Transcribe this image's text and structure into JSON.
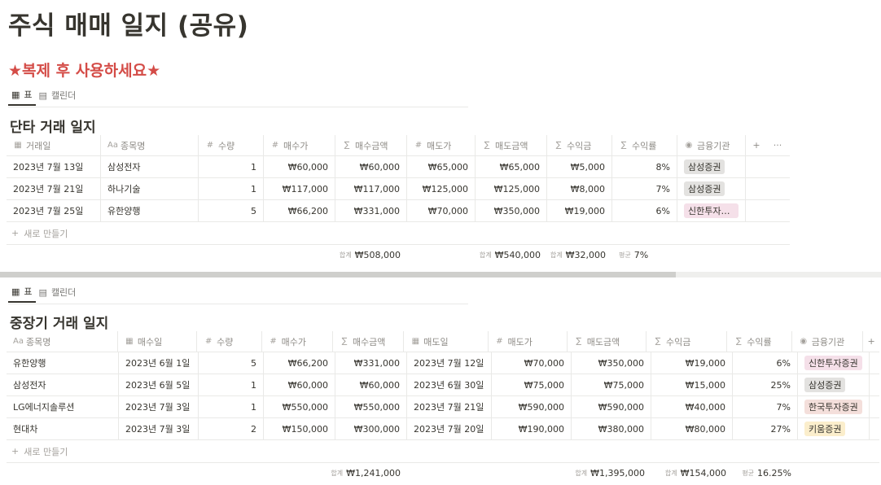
{
  "page_title": "주식 매매 일지 (공유)",
  "notice": "★복제 후 사용하세요★",
  "tabs": {
    "table": "표",
    "calendar": "캘린더"
  },
  "new_row_label": "새로 만들기",
  "short_term": {
    "title": "단타 거래 일지",
    "columns": [
      {
        "icon": "▦",
        "label": "거래일"
      },
      {
        "icon": "Aa",
        "label": "종목명"
      },
      {
        "icon": "#",
        "label": "수량"
      },
      {
        "icon": "#",
        "label": "매수가"
      },
      {
        "icon": "∑",
        "label": "매수금액"
      },
      {
        "icon": "#",
        "label": "매도가"
      },
      {
        "icon": "∑",
        "label": "매도금액"
      },
      {
        "icon": "∑",
        "label": "수익금"
      },
      {
        "icon": "∑",
        "label": "수익률"
      },
      {
        "icon": "◉",
        "label": "금융기관"
      }
    ],
    "rows": [
      {
        "date": "2023년 7월 13일",
        "name": "삼성전자",
        "qty": "1",
        "buy_price": "₩60,000",
        "buy_amount": "₩60,000",
        "sell_price": "₩65,000",
        "sell_amount": "₩65,000",
        "profit": "₩5,000",
        "rate": "8%",
        "broker": "삼성증권",
        "broker_color": "#e3e2e0"
      },
      {
        "date": "2023년 7월 21일",
        "name": "하나기술",
        "qty": "1",
        "buy_price": "₩117,000",
        "buy_amount": "₩117,000",
        "sell_price": "₩125,000",
        "sell_amount": "₩125,000",
        "profit": "₩8,000",
        "rate": "7%",
        "broker": "삼성증권",
        "broker_color": "#e3e2e0"
      },
      {
        "date": "2023년 7월 25일",
        "name": "유한양행",
        "qty": "5",
        "buy_price": "₩66,200",
        "buy_amount": "₩331,000",
        "sell_price": "₩70,000",
        "sell_amount": "₩350,000",
        "profit": "₩19,000",
        "rate": "6%",
        "broker": "신한투자증권",
        "broker_color": "#f5e0e9"
      }
    ],
    "footer": {
      "buy_amount_label": "합계",
      "buy_amount": "₩508,000",
      "sell_amount_label": "합계",
      "sell_amount": "₩540,000",
      "profit_label": "합계",
      "profit": "₩32,000",
      "rate_label": "평균",
      "rate": "7%"
    }
  },
  "mid_term": {
    "title": "중장기 거래 일지",
    "columns": [
      {
        "icon": "Aa",
        "label": "종목명"
      },
      {
        "icon": "▦",
        "label": "매수일"
      },
      {
        "icon": "#",
        "label": "수량"
      },
      {
        "icon": "#",
        "label": "매수가"
      },
      {
        "icon": "∑",
        "label": "매수금액"
      },
      {
        "icon": "▦",
        "label": "매도일"
      },
      {
        "icon": "#",
        "label": "매도가"
      },
      {
        "icon": "∑",
        "label": "매도금액"
      },
      {
        "icon": "∑",
        "label": "수익금"
      },
      {
        "icon": "∑",
        "label": "수익률"
      },
      {
        "icon": "◉",
        "label": "금융기관"
      }
    ],
    "rows": [
      {
        "name": "유한양행",
        "buy_date": "2023년 6월 1일",
        "qty": "5",
        "buy_price": "₩66,200",
        "buy_amount": "₩331,000",
        "sell_date": "2023년 7월 12일",
        "sell_price": "₩70,000",
        "sell_amount": "₩350,000",
        "profit": "₩19,000",
        "rate": "6%",
        "broker": "신한투자증권",
        "broker_color": "#f5e0e9"
      },
      {
        "name": "삼성전자",
        "buy_date": "2023년 6월 5일",
        "qty": "1",
        "buy_price": "₩60,000",
        "buy_amount": "₩60,000",
        "sell_date": "2023년 6월 30일",
        "sell_price": "₩75,000",
        "sell_amount": "₩75,000",
        "profit": "₩15,000",
        "rate": "25%",
        "broker": "삼성증권",
        "broker_color": "#e3e2e0"
      },
      {
        "name": "LG에너지솔루션",
        "buy_date": "2023년 7월 3일",
        "qty": "1",
        "buy_price": "₩550,000",
        "buy_amount": "₩550,000",
        "sell_date": "2023년 7월 21일",
        "sell_price": "₩590,000",
        "sell_amount": "₩590,000",
        "profit": "₩40,000",
        "rate": "7%",
        "broker": "한국투자증권",
        "broker_color": "#f4dfdb"
      },
      {
        "name": "현대차",
        "buy_date": "2023년 7월 3일",
        "qty": "2",
        "buy_price": "₩150,000",
        "buy_amount": "₩300,000",
        "sell_date": "2023년 7월 20일",
        "sell_price": "₩190,000",
        "sell_amount": "₩380,000",
        "profit": "₩80,000",
        "rate": "27%",
        "broker": "키움증권",
        "broker_color": "#fbeecc"
      }
    ],
    "footer": {
      "buy_amount_label": "합계",
      "buy_amount": "₩1,241,000",
      "sell_amount_label": "합계",
      "sell_amount": "₩1,395,000",
      "profit_label": "합계",
      "profit": "₩154,000",
      "rate_label": "평균",
      "rate": "16.25%"
    }
  }
}
